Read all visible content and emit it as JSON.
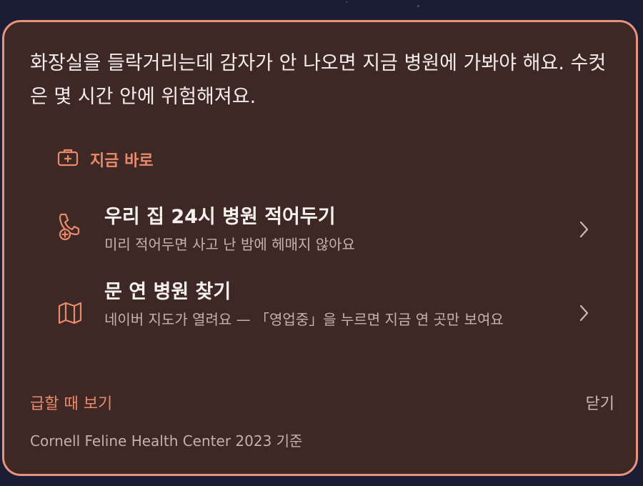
{
  "card": {
    "headline": "화장실을 들락거리는데 감자가 안 나오면 지금 병원에 가봐야 해요. 수컷은 몇 시간 안에 위험해져요.",
    "section_label": "지금 바로",
    "actions": [
      {
        "title": "우리 집 24시 병원 적어두기",
        "subtitle": "미리 적어두면 사고 난 밤에 헤매지 않아요",
        "icon": "phone-add-icon"
      },
      {
        "title": "문 연 병원 찾기",
        "subtitle": "네이버 지도가 열려요 — 「영업중」을 누르면 지금 연 곳만 보여요",
        "icon": "map-icon"
      }
    ],
    "footer_link": "급할 때 보기",
    "close_label": "닫기",
    "source": "Cornell Feline Health Center 2023 기준"
  },
  "colors": {
    "accent": "#ea8a6a",
    "card_background": "#3d2826",
    "card_border": "#e9937a",
    "page_background": "#1a1d33"
  }
}
